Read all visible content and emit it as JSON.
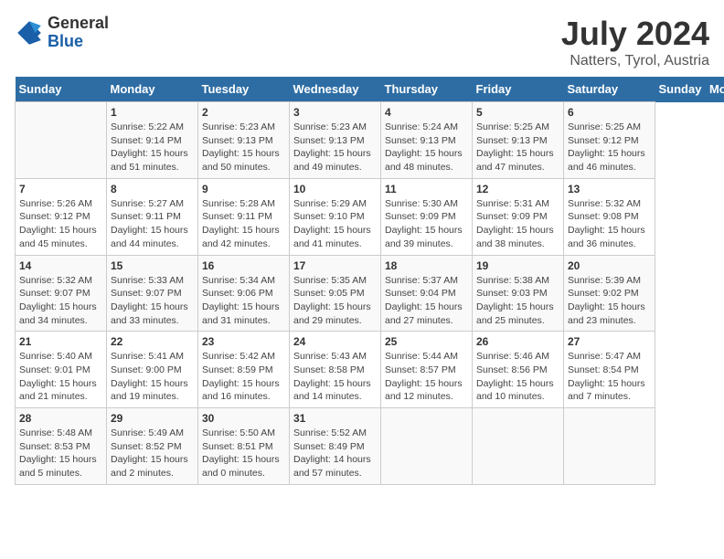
{
  "logo": {
    "general": "General",
    "blue": "Blue"
  },
  "header": {
    "title": "July 2024",
    "subtitle": "Natters, Tyrol, Austria"
  },
  "days_of_week": [
    "Sunday",
    "Monday",
    "Tuesday",
    "Wednesday",
    "Thursday",
    "Friday",
    "Saturday"
  ],
  "weeks": [
    [
      {
        "day": "",
        "info": ""
      },
      {
        "day": "1",
        "info": "Sunrise: 5:22 AM\nSunset: 9:14 PM\nDaylight: 15 hours\nand 51 minutes."
      },
      {
        "day": "2",
        "info": "Sunrise: 5:23 AM\nSunset: 9:13 PM\nDaylight: 15 hours\nand 50 minutes."
      },
      {
        "day": "3",
        "info": "Sunrise: 5:23 AM\nSunset: 9:13 PM\nDaylight: 15 hours\nand 49 minutes."
      },
      {
        "day": "4",
        "info": "Sunrise: 5:24 AM\nSunset: 9:13 PM\nDaylight: 15 hours\nand 48 minutes."
      },
      {
        "day": "5",
        "info": "Sunrise: 5:25 AM\nSunset: 9:13 PM\nDaylight: 15 hours\nand 47 minutes."
      },
      {
        "day": "6",
        "info": "Sunrise: 5:25 AM\nSunset: 9:12 PM\nDaylight: 15 hours\nand 46 minutes."
      }
    ],
    [
      {
        "day": "7",
        "info": "Sunrise: 5:26 AM\nSunset: 9:12 PM\nDaylight: 15 hours\nand 45 minutes."
      },
      {
        "day": "8",
        "info": "Sunrise: 5:27 AM\nSunset: 9:11 PM\nDaylight: 15 hours\nand 44 minutes."
      },
      {
        "day": "9",
        "info": "Sunrise: 5:28 AM\nSunset: 9:11 PM\nDaylight: 15 hours\nand 42 minutes."
      },
      {
        "day": "10",
        "info": "Sunrise: 5:29 AM\nSunset: 9:10 PM\nDaylight: 15 hours\nand 41 minutes."
      },
      {
        "day": "11",
        "info": "Sunrise: 5:30 AM\nSunset: 9:09 PM\nDaylight: 15 hours\nand 39 minutes."
      },
      {
        "day": "12",
        "info": "Sunrise: 5:31 AM\nSunset: 9:09 PM\nDaylight: 15 hours\nand 38 minutes."
      },
      {
        "day": "13",
        "info": "Sunrise: 5:32 AM\nSunset: 9:08 PM\nDaylight: 15 hours\nand 36 minutes."
      }
    ],
    [
      {
        "day": "14",
        "info": "Sunrise: 5:32 AM\nSunset: 9:07 PM\nDaylight: 15 hours\nand 34 minutes."
      },
      {
        "day": "15",
        "info": "Sunrise: 5:33 AM\nSunset: 9:07 PM\nDaylight: 15 hours\nand 33 minutes."
      },
      {
        "day": "16",
        "info": "Sunrise: 5:34 AM\nSunset: 9:06 PM\nDaylight: 15 hours\nand 31 minutes."
      },
      {
        "day": "17",
        "info": "Sunrise: 5:35 AM\nSunset: 9:05 PM\nDaylight: 15 hours\nand 29 minutes."
      },
      {
        "day": "18",
        "info": "Sunrise: 5:37 AM\nSunset: 9:04 PM\nDaylight: 15 hours\nand 27 minutes."
      },
      {
        "day": "19",
        "info": "Sunrise: 5:38 AM\nSunset: 9:03 PM\nDaylight: 15 hours\nand 25 minutes."
      },
      {
        "day": "20",
        "info": "Sunrise: 5:39 AM\nSunset: 9:02 PM\nDaylight: 15 hours\nand 23 minutes."
      }
    ],
    [
      {
        "day": "21",
        "info": "Sunrise: 5:40 AM\nSunset: 9:01 PM\nDaylight: 15 hours\nand 21 minutes."
      },
      {
        "day": "22",
        "info": "Sunrise: 5:41 AM\nSunset: 9:00 PM\nDaylight: 15 hours\nand 19 minutes."
      },
      {
        "day": "23",
        "info": "Sunrise: 5:42 AM\nSunset: 8:59 PM\nDaylight: 15 hours\nand 16 minutes."
      },
      {
        "day": "24",
        "info": "Sunrise: 5:43 AM\nSunset: 8:58 PM\nDaylight: 15 hours\nand 14 minutes."
      },
      {
        "day": "25",
        "info": "Sunrise: 5:44 AM\nSunset: 8:57 PM\nDaylight: 15 hours\nand 12 minutes."
      },
      {
        "day": "26",
        "info": "Sunrise: 5:46 AM\nSunset: 8:56 PM\nDaylight: 15 hours\nand 10 minutes."
      },
      {
        "day": "27",
        "info": "Sunrise: 5:47 AM\nSunset: 8:54 PM\nDaylight: 15 hours\nand 7 minutes."
      }
    ],
    [
      {
        "day": "28",
        "info": "Sunrise: 5:48 AM\nSunset: 8:53 PM\nDaylight: 15 hours\nand 5 minutes."
      },
      {
        "day": "29",
        "info": "Sunrise: 5:49 AM\nSunset: 8:52 PM\nDaylight: 15 hours\nand 2 minutes."
      },
      {
        "day": "30",
        "info": "Sunrise: 5:50 AM\nSunset: 8:51 PM\nDaylight: 15 hours\nand 0 minutes."
      },
      {
        "day": "31",
        "info": "Sunrise: 5:52 AM\nSunset: 8:49 PM\nDaylight: 14 hours\nand 57 minutes."
      },
      {
        "day": "",
        "info": ""
      },
      {
        "day": "",
        "info": ""
      },
      {
        "day": "",
        "info": ""
      }
    ]
  ]
}
